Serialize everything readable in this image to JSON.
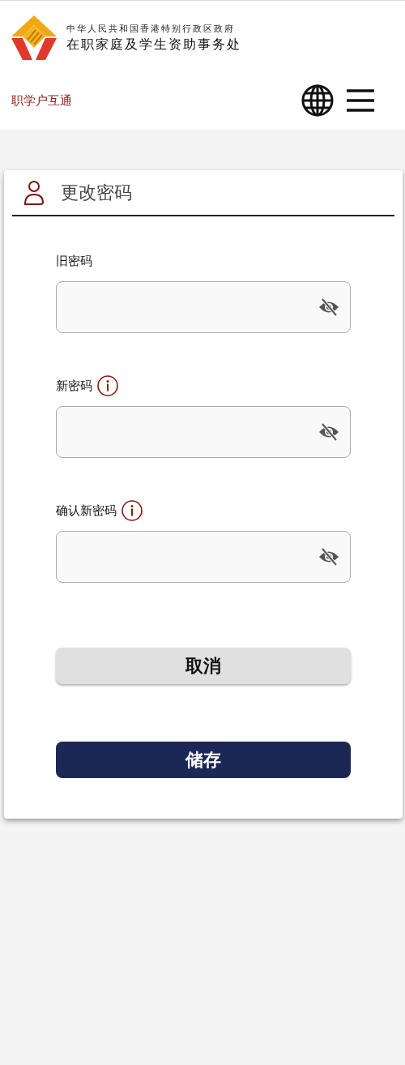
{
  "header": {
    "org_line_1": "中华人民共和国香港特别行政区政府",
    "org_line_2": "在职家庭及学生资助事务处",
    "app_name": "职学户互通"
  },
  "card": {
    "title": "更改密码",
    "fields": [
      {
        "label": "旧密码",
        "kind": "plain"
      },
      {
        "label": "新密码",
        "kind": "hinted"
      },
      {
        "label": "确认新密码",
        "kind": "hinted"
      }
    ],
    "buttons": [
      {
        "label": "取消",
        "kind": "secondary"
      },
      {
        "label": "储存",
        "kind": "primary"
      }
    ]
  }
}
